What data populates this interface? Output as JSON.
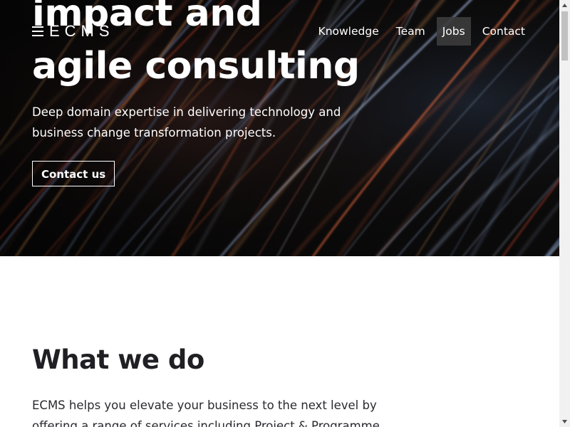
{
  "brand": {
    "logo_text": "ECMS"
  },
  "nav": {
    "items": [
      {
        "label": "Knowledge",
        "active": false
      },
      {
        "label": "Team",
        "active": false
      },
      {
        "label": "Jobs",
        "active": true
      },
      {
        "label": "Contact",
        "active": false
      }
    ]
  },
  "hero": {
    "title_line_1": "impact and",
    "title_line_2": "agile consulting",
    "description": "Deep domain expertise in delivering technology and business change transformation projects.",
    "cta_label": "Contact us"
  },
  "what_we_do": {
    "title": "What we do",
    "text": "ECMS helps you elevate your business to the next level by offering a range of services including Project & Programme"
  },
  "colors": {
    "hero_background": "#0b0a0a",
    "nav_active_background": "#3c3c3c",
    "heading_text": "#1f1f24",
    "body_text": "#2a2a30",
    "scrollbar_track": "#f1f1f1",
    "scrollbar_thumb": "#c1c1c1"
  },
  "icons": {
    "logo": "ecms-logo-icon",
    "scroll_up": "scroll-up-arrow-icon",
    "scroll_down": "scroll-down-arrow-icon"
  }
}
